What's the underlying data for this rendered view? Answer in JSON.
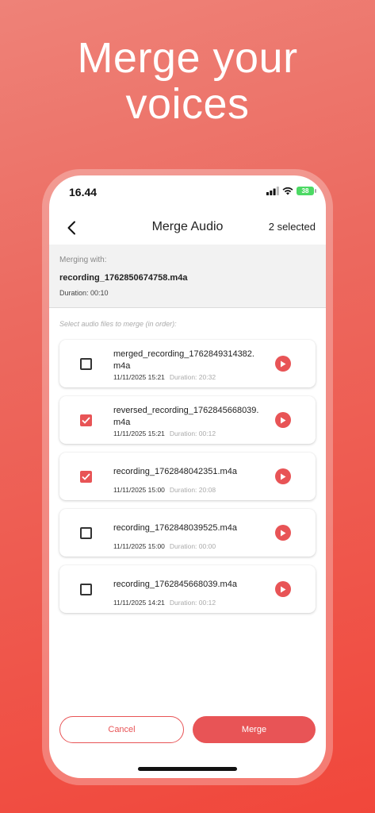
{
  "headline": {
    "line1": "Merge your",
    "line2": "voices"
  },
  "status_bar": {
    "time": "16.44",
    "battery": "38"
  },
  "appbar": {
    "title": "Merge Audio",
    "selected": "2 selected"
  },
  "merge_info": {
    "label": "Merging with:",
    "file": "recording_1762850674758.m4a",
    "duration": "Duration: 00:10"
  },
  "hint": "Select audio files to merge (in order):",
  "files": [
    {
      "name": "merged_recording_1762849314382.m4a",
      "date": "11/11/2025 15:21",
      "duration": "Duration: 20:32",
      "checked": false
    },
    {
      "name": "reversed_recording_1762845668039.m4a",
      "date": "11/11/2025 15:21",
      "duration": "Duration: 00:12",
      "checked": true
    },
    {
      "name": "recording_1762848042351.m4a",
      "date": "11/11/2025 15:00",
      "duration": "Duration: 20:08",
      "checked": true
    },
    {
      "name": "recording_1762848039525.m4a",
      "date": "11/11/2025 15:00",
      "duration": "Duration: 00:00",
      "checked": false
    },
    {
      "name": "recording_1762845668039.m4a",
      "date": "11/11/2025 14:21",
      "duration": "Duration: 00:12",
      "checked": false
    }
  ],
  "footer": {
    "cancel": "Cancel",
    "merge": "Merge"
  },
  "colors": {
    "accent": "#e85456",
    "battery": "#4cd964"
  },
  "icons": [
    "back-arrow-icon",
    "cellular-signal-icon",
    "wifi-icon",
    "battery-icon",
    "checkbox-icon",
    "play-icon"
  ]
}
